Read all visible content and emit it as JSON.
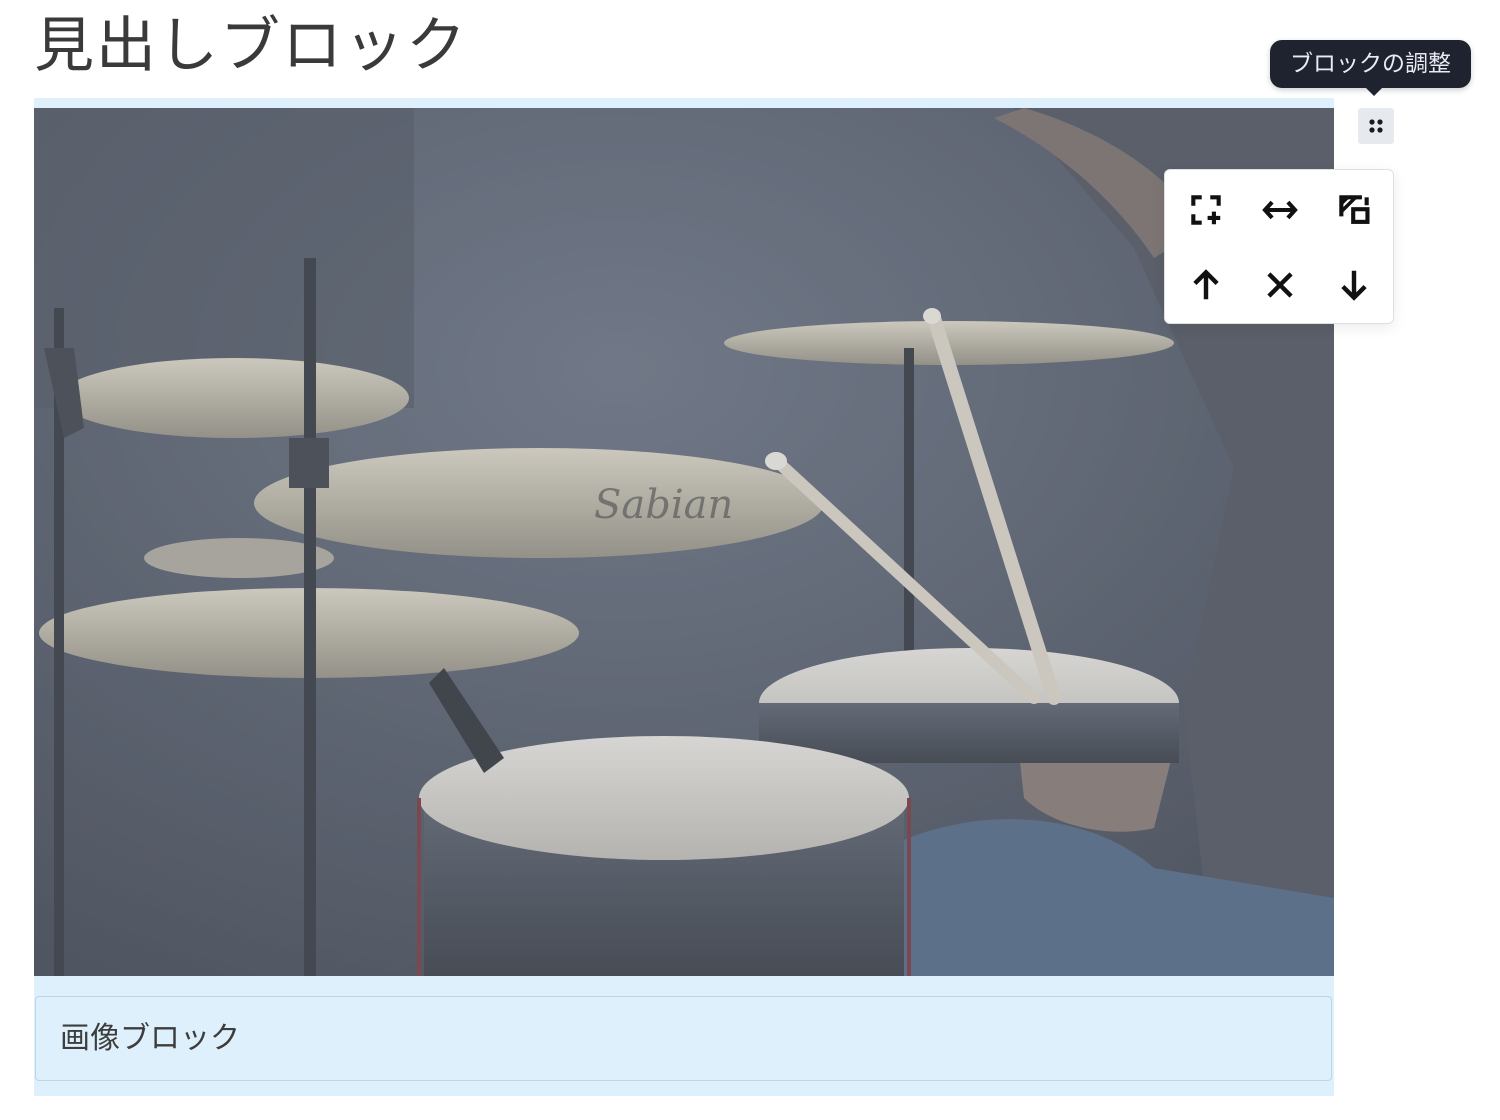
{
  "heading": {
    "text": "見出しブロック"
  },
  "image_block": {
    "caption": "画像ブロック"
  },
  "toolbar": {
    "tooltip": "ブロックの調整",
    "handle_icon": "drag-handle-icon",
    "menu_items": [
      {
        "icon": "add-block-icon"
      },
      {
        "icon": "resize-horizontal-icon"
      },
      {
        "icon": "replace-image-icon"
      },
      {
        "icon": "move-up-icon"
      },
      {
        "icon": "delete-icon"
      },
      {
        "icon": "move-down-icon"
      }
    ]
  },
  "colors": {
    "selected_block_background": "#dff0fd",
    "tooltip_background": "#1f2330",
    "icon_color": "#111111"
  }
}
